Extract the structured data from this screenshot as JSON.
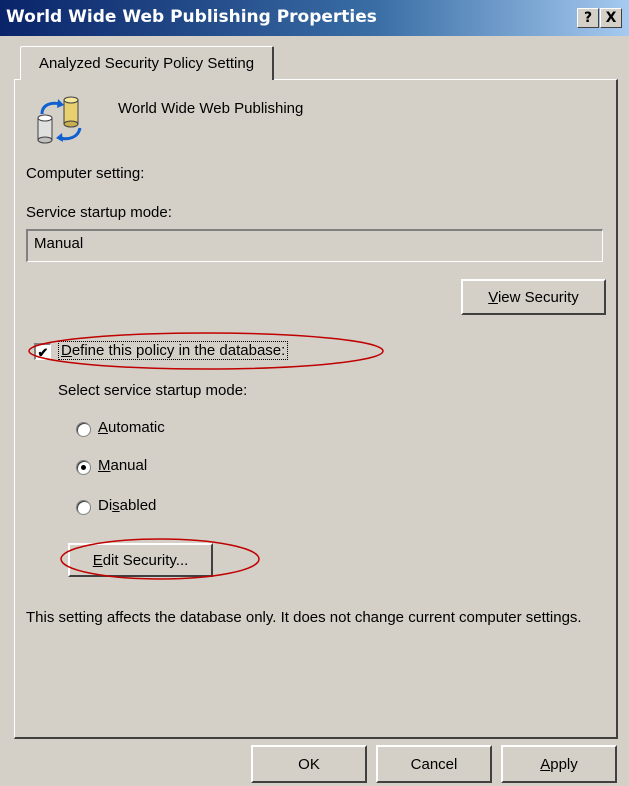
{
  "window": {
    "title": "World Wide Web Publishing Properties",
    "help_button": "?",
    "close_button": "X"
  },
  "tab": {
    "label": "Analyzed Security Policy Setting"
  },
  "service": {
    "name": "World Wide Web Publishing"
  },
  "computer_setting": {
    "heading": "Computer setting:",
    "startup_label": "Service startup mode:",
    "startup_value": "Manual"
  },
  "buttons": {
    "view_security": "View Security",
    "edit_security": "Edit Security...",
    "ok": "OK",
    "cancel": "Cancel",
    "apply": "Apply"
  },
  "policy": {
    "define_label": "Define this policy in the database:",
    "define_checked": true,
    "select_label": "Select service startup mode:",
    "options": [
      "Automatic",
      "Manual",
      "Disabled"
    ],
    "selected": "Manual"
  },
  "note": "This setting affects the database only. It does not change current computer settings.",
  "colors": {
    "title_start": "#0a246a",
    "title_end": "#a6caf0",
    "face": "#d4d0c8",
    "highlight_ellipse": "#c00000"
  },
  "icons": {
    "service": "service-database-icon",
    "checkbox": "checkmark-icon"
  }
}
